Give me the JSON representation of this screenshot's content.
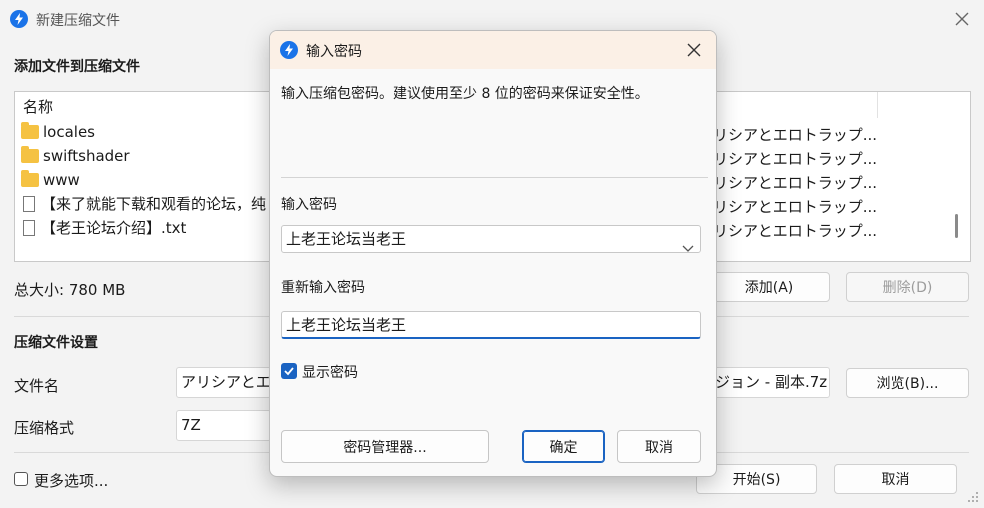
{
  "window": {
    "title": "新建压缩文件"
  },
  "files_section": {
    "title": "添加文件到压缩文件",
    "column_name": "名称"
  },
  "file_list": [
    {
      "name": "locales",
      "type": "folder",
      "right_text": "リシアとエロトラップ..."
    },
    {
      "name": "swiftshader",
      "type": "folder",
      "right_text": "リシアとエロトラップ..."
    },
    {
      "name": "www",
      "type": "folder",
      "right_text": "リシアとエロトラップ..."
    },
    {
      "name": "【来了就能下载和观看的论坛，纯",
      "type": "file",
      "right_text": "リシアとエロトラップ..."
    },
    {
      "name": "【老王论坛介绍】.txt",
      "type": "file",
      "right_text": "リシアとエロトラップ..."
    }
  ],
  "total_size": "总大小: 780 MB",
  "buttons": {
    "add": "添加(A)",
    "delete": "删除(D)",
    "browse": "浏览(B)...",
    "start": "开始(S)",
    "cancel": "取消"
  },
  "settings": {
    "title": "压缩文件设置",
    "filename_label": "文件名",
    "filename_value_left": "アリシアとエ",
    "filename_value_right": "ジョン - 副本.7z",
    "format_label": "压缩格式",
    "format_value": "7Z"
  },
  "more_options": "更多选项...",
  "dialog": {
    "title": "输入密码",
    "description": "输入压缩包密码。建议使用至少 8 位的密码来保证安全性。",
    "password_label": "输入密码",
    "password_value": "上老王论坛当老王",
    "confirm_label": "重新输入密码",
    "confirm_value": "上老王论坛当老王",
    "show_password": "显示密码",
    "show_password_checked": true,
    "manager_button": "密码管理器...",
    "ok_button": "确定",
    "cancel_button": "取消"
  },
  "colors": {
    "accent": "#1a63c2",
    "dialog_title_bg": "#fbf0e6"
  },
  "icons": {
    "app": "bolt-icon",
    "close": "close-icon",
    "folder": "folder-icon",
    "file": "file-icon",
    "dropdown": "chevron-down-icon",
    "check": "check-icon"
  }
}
